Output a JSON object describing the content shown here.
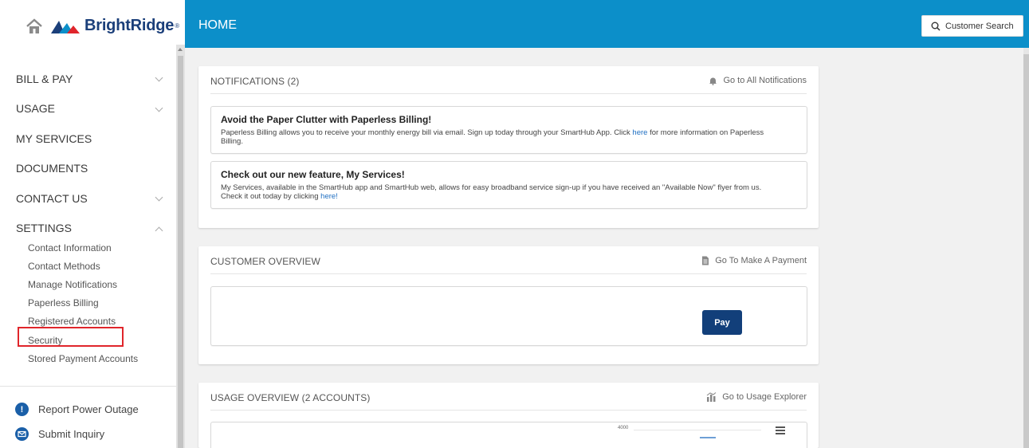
{
  "brand": {
    "name": "BrightRidge",
    "reg": "®"
  },
  "header": {
    "title": "HOME",
    "search_label": "Customer Search"
  },
  "sidebar": {
    "items": [
      {
        "label": "BILL & PAY",
        "chevron": "down"
      },
      {
        "label": "USAGE",
        "chevron": "down"
      },
      {
        "label": "MY SERVICES"
      },
      {
        "label": "DOCUMENTS"
      },
      {
        "label": "CONTACT US",
        "chevron": "down"
      },
      {
        "label": "SETTINGS",
        "chevron": "up"
      }
    ],
    "settings_sub": [
      "Contact Information",
      "Contact Methods",
      "Manage Notifications",
      "Paperless Billing",
      "Registered Accounts",
      "Security",
      "Stored Payment Accounts"
    ],
    "bottom_links": [
      {
        "label": "Report Power Outage",
        "icon": "alert-icon"
      },
      {
        "label": "Submit Inquiry",
        "icon": "mail-icon"
      }
    ]
  },
  "notifications": {
    "title": "NOTIFICATIONS (2)",
    "link": "Go to All Notifications",
    "items": [
      {
        "title": "Avoid the Paper Clutter with Paperless Billing!",
        "body_before": "Paperless Billing allows you to receive your monthly energy bill via email. Sign up today through your SmartHub App. Click ",
        "link_text": "here",
        "body_after": " for more information on Paperless Billing."
      },
      {
        "title": "Check out our new feature, My Services!",
        "body_before": "My Services, available in the SmartHub app and SmartHub web, allows for easy broadband service sign-up if you have received an \"Available Now\" flyer from us. Check it out today by clicking ",
        "link_text": "here!",
        "body_after": ""
      }
    ]
  },
  "customer_overview": {
    "title": "CUSTOMER OVERVIEW",
    "link": "Go To Make A Payment",
    "pay_label": "Pay"
  },
  "usage_overview": {
    "title": "USAGE OVERVIEW (2 Accounts)",
    "link": "Go to Usage Explorer",
    "chart_axis_label": "4000"
  },
  "colors": {
    "header": "#0c8fc9",
    "brand": "#1b3f7a",
    "pay_button": "#123f7a",
    "highlight": "#e0252b",
    "link": "#1f6fc2"
  }
}
